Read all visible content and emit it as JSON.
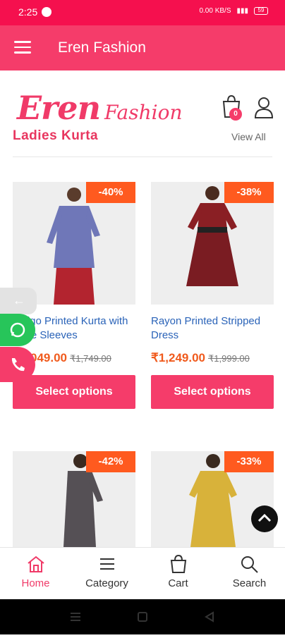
{
  "status": {
    "time": "2:25",
    "net": "0.00 KB/S",
    "battery": "59"
  },
  "app_bar": {
    "title": "Eren Fashion"
  },
  "logo": {
    "part1": "Eren",
    "part2": "Fashion"
  },
  "cart_badge": "0",
  "section": {
    "title": "Ladies Kurta",
    "view_all": "View All"
  },
  "products": [
    {
      "discount": "-40%",
      "name": "Indigo Printed Kurta with Flare Sleeves",
      "price": "₹1,049.00",
      "old_price": "₹1,749.00",
      "button": "Select options"
    },
    {
      "discount": "-38%",
      "name": "Rayon Printed Stripped Dress",
      "price": "₹1,249.00",
      "old_price": "₹1,999.00",
      "button": "Select options"
    },
    {
      "discount": "-42%"
    },
    {
      "discount": "-33%"
    }
  ],
  "side": {
    "back": "←"
  },
  "nav": {
    "home": "Home",
    "category": "Category",
    "cart": "Cart",
    "search": "Search"
  },
  "colors": {
    "primary": "#f53c6a",
    "status": "#f5104e",
    "discount": "#ff5a1f",
    "price": "#f05a1c",
    "link": "#2a63b8"
  }
}
